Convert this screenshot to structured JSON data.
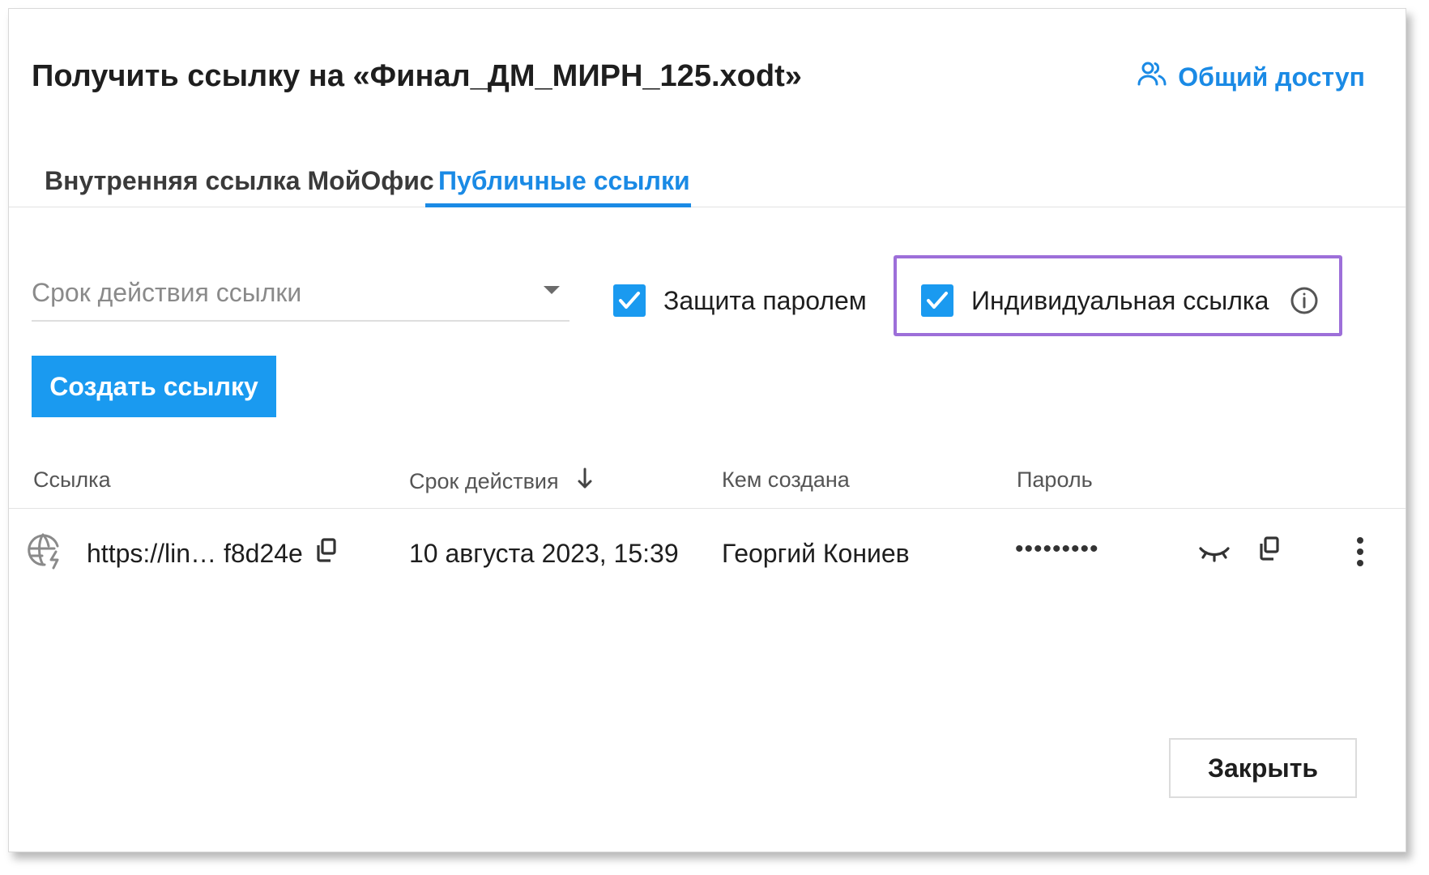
{
  "dialog": {
    "title": "Получить ссылку на «Финал_ДМ_МИРН_125.xodt»",
    "share_label": "Общий доступ",
    "icons": {
      "share": "users-icon"
    }
  },
  "tabs": [
    {
      "label": "Внутренняя ссылка МойОфис",
      "active": false
    },
    {
      "label": "Публичные ссылки",
      "active": true
    }
  ],
  "form": {
    "expiry_placeholder": "Срок действия ссылки",
    "password_protect_label": "Защита паролем",
    "password_protect_checked": true,
    "individual_link_label": "Индивидуальная ссылка",
    "individual_link_checked": true,
    "create_button": "Создать ссылку"
  },
  "table": {
    "columns": [
      "Ссылка",
      "Срок действия",
      "Кем создана",
      "Пароль"
    ],
    "rows": [
      {
        "url": "https://lin… f8d24e",
        "expires": "10 августа 2023, 15:39",
        "created_by": "Георгий Кониев",
        "password": "•••••••••"
      }
    ]
  },
  "footer": {
    "close_button": "Закрыть"
  },
  "colors": {
    "accent": "#1a8ae5",
    "button": "#1a9af0",
    "highlight": "#9d6fd9"
  }
}
